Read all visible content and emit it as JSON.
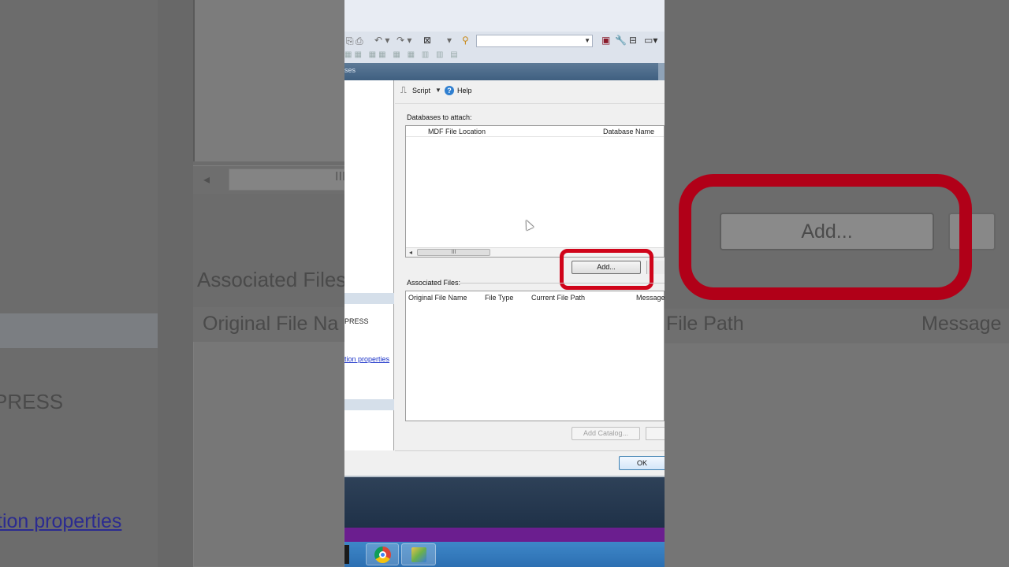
{
  "toolbar": {
    "combo_value": ""
  },
  "window": {
    "title_fragment": "ses"
  },
  "left_pane": {
    "server_fragment": "PRESS",
    "link_fragment": "tion properties"
  },
  "dialog_toolbar": {
    "script_label": "Script",
    "help_label": "Help"
  },
  "databases": {
    "section_label": "Databases to attach:",
    "columns": [
      "MDF File Location",
      "Database Name"
    ],
    "scroll_grip": "III",
    "add_button": "Add..."
  },
  "associated": {
    "section_label": "Associated Files:",
    "columns": [
      "Original File Name",
      "File Type",
      "Current File Path",
      "Message"
    ],
    "add_catalog_button": "Add Catalog..."
  },
  "footer": {
    "ok_button": "OK"
  },
  "zoomed_background": {
    "associated_label": "Associated Files",
    "original_file_name": "Original File Na",
    "server_fragment": "PRESS",
    "link_fragment": "tion properties",
    "current_file_path": "File Path",
    "message": "Message",
    "add_button": "Add..."
  },
  "colors": {
    "highlight_ring": "#d0041a",
    "title_bar": "#3f5f80",
    "link": "#1a32c8"
  },
  "icons": [
    "script-icon",
    "help-icon",
    "chrome-icon",
    "app-icon"
  ]
}
